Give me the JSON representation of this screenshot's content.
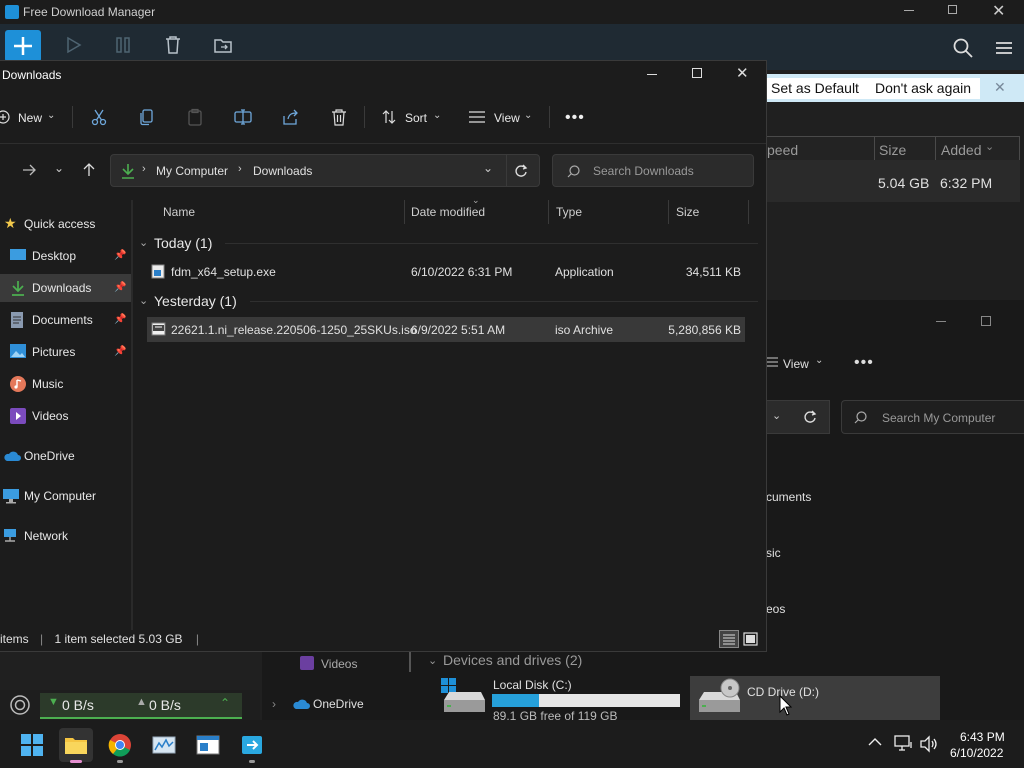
{
  "fdm": {
    "title": "Free Download Manager",
    "notice_set_default": "Set as Default",
    "notice_dont_ask": "Don't ask again",
    "col_speed": "peed",
    "col_size": "Size",
    "col_added": "Added",
    "row_size": "5.04 GB",
    "row_added": "6:32 PM",
    "down_speed": "0 B/s",
    "up_speed": "0 B/s"
  },
  "explorer": {
    "title": "Downloads",
    "cmd": {
      "new": "New",
      "sort": "Sort",
      "view": "View"
    },
    "breadcrumb": [
      "My Computer",
      "Downloads"
    ],
    "search_placeholder": "Search Downloads",
    "nav": {
      "quick_access": "Quick access",
      "desktop": "Desktop",
      "downloads": "Downloads",
      "documents": "Documents",
      "pictures": "Pictures",
      "music": "Music",
      "videos": "Videos",
      "onedrive": "OneDrive",
      "my_computer": "My Computer",
      "network": "Network"
    },
    "columns": {
      "name": "Name",
      "date": "Date modified",
      "type": "Type",
      "size": "Size"
    },
    "groups": {
      "today": "Today (1)",
      "yesterday": "Yesterday (1)"
    },
    "files": [
      {
        "name": "fdm_x64_setup.exe",
        "date": "6/10/2022 6:31 PM",
        "type": "Application",
        "size": "34,511 KB"
      },
      {
        "name": "22621.1.ni_release.220506-1250_25SKUs.iso",
        "date": "6/9/2022 5:51 AM",
        "type": "iso Archive",
        "size": "5,280,856 KB"
      }
    ],
    "status": {
      "items": "items",
      "selected": "1 item selected  5.03 GB"
    }
  },
  "mycomputer": {
    "view": "View",
    "search_placeholder": "Search My Computer",
    "frag_documents": "cuments",
    "frag_music": "sic",
    "frag_videos": "eos",
    "videos": "Videos",
    "onedrive": "OneDrive",
    "devices_header": "Devices and drives (2)",
    "drive_c": "Local Disk (C:)",
    "drive_c_free": "89.1 GB free of 119 GB",
    "drive_c_used_fraction": 0.25,
    "drive_d": "CD Drive (D:)"
  },
  "taskbar": {
    "time": "6:43 PM",
    "date": "6/10/2022"
  },
  "colors": {
    "accent": "#1e90d8",
    "selection": "#393939",
    "drive_bar": "#26a0da"
  }
}
